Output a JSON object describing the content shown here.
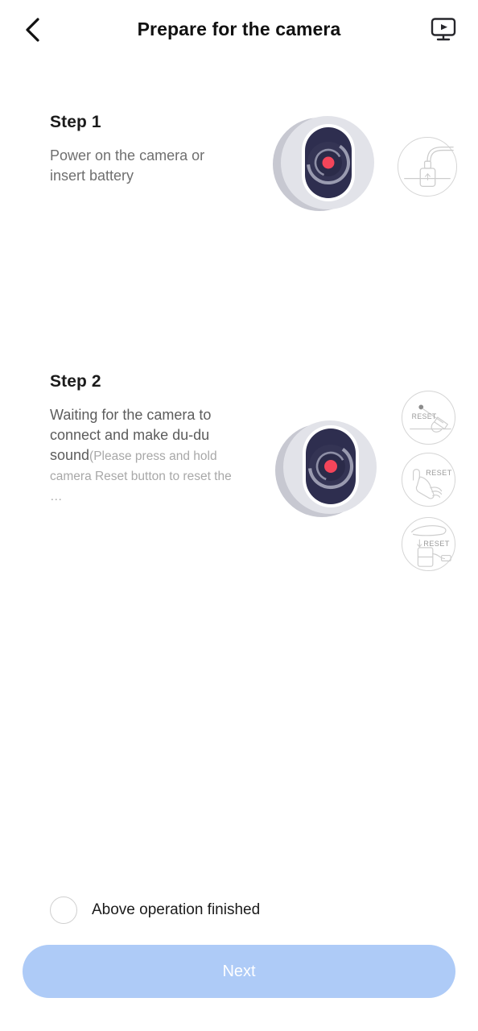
{
  "header": {
    "back_icon": "chevron-left-icon",
    "title": "Prepare for the camera",
    "tutorial_icon": "video-monitor-play-icon"
  },
  "steps": [
    {
      "title": "Step 1",
      "desc": "Power on the camera or insert battery",
      "desc_strong": "",
      "desc_note": "",
      "camera_icon": "camera-illustration",
      "side_icons": [
        "power-adapter-icon"
      ]
    },
    {
      "title": "Step 2",
      "desc_strong": "Waiting for the camera to connect and make du-du sound",
      "desc_note": "(Please press and hold camera Reset button to reset the …",
      "camera_icon": "camera-illustration",
      "side_icons": [
        "reset-pin-icon",
        "reset-finger-icon",
        "reset-device-icon"
      ]
    }
  ],
  "reset_label": "RESET",
  "footer": {
    "checkbox_label": "Above operation finished",
    "checkbox_checked": false,
    "next_label": "Next"
  },
  "colors": {
    "button_disabled": "#aecbf7",
    "camera_body": "#d6d7de",
    "camera_body_dark": "#c5c6ce",
    "camera_lens": "#2e2e4f",
    "camera_dot": "#f4455a",
    "title_text": "#111111",
    "body_text": "#6f6f6f",
    "note_text": "#a8a8a8",
    "icon_outline": "#d5d5d5"
  }
}
